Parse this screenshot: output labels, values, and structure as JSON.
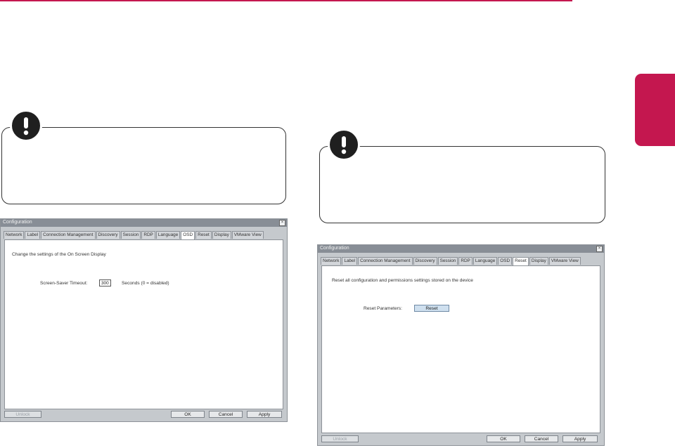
{
  "colors": {
    "accent": "#c4174f",
    "window_frame": "#c5c9cd",
    "titlebar": "#888e96"
  },
  "notes": [
    {
      "icon": "exclamation-icon"
    },
    {
      "icon": "exclamation-icon"
    }
  ],
  "left_window": {
    "title": "Configuration",
    "tabs": [
      "Network",
      "Label",
      "Connection Management",
      "Discovery",
      "Session",
      "RDP",
      "Language",
      "OSD",
      "Reset",
      "Display",
      "VMware View"
    ],
    "active_tab": "OSD",
    "description": "Change the settings of the On Screen Display",
    "field_label": "Screen-Saver Timeout:",
    "field_value": "300",
    "field_hint": "Seconds (0 = disabled)",
    "unlock_label": "Unlock",
    "ok_label": "OK",
    "cancel_label": "Cancel",
    "apply_label": "Apply"
  },
  "right_window": {
    "title": "Configuration",
    "tabs": [
      "Network",
      "Label",
      "Connection Management",
      "Discovery",
      "Session",
      "RDP",
      "Language",
      "OSD",
      "Reset",
      "Display",
      "VMware View"
    ],
    "active_tab": "Reset",
    "description": "Reset all configuration and permissions settings stored on the device",
    "field_label": "Reset Parameters:",
    "reset_button": "Reset",
    "unlock_label": "Unlock",
    "ok_label": "OK",
    "cancel_label": "Cancel",
    "apply_label": "Apply"
  }
}
